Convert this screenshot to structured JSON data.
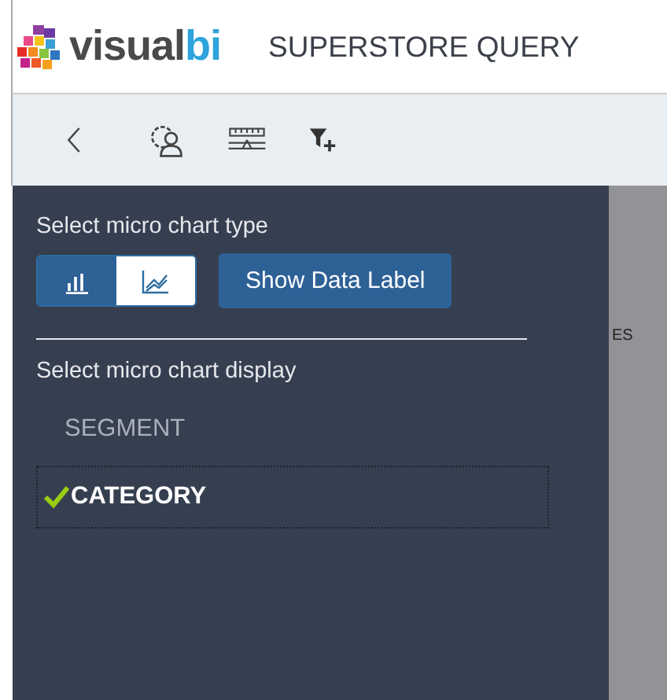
{
  "header": {
    "logo": {
      "text": "visual",
      "accent": "bi"
    },
    "title": "SUPERSTORE QUERY"
  },
  "toolbar": {
    "buttons": [
      {
        "kind": "back"
      },
      {
        "kind": "settings"
      },
      {
        "kind": "ruler"
      },
      {
        "kind": "filter"
      }
    ]
  },
  "background": {
    "text": "ES"
  },
  "panel": {
    "chart_type_label": "Select micro chart type",
    "chart_types": [
      {
        "kind": "bar",
        "selected": true
      },
      {
        "kind": "line",
        "selected": false
      }
    ],
    "data_label_button": "Show Data Label",
    "display_label": "Select micro chart display",
    "display_items": [
      {
        "label": "SEGMENT",
        "checked": false
      },
      {
        "label": "CATEGORY",
        "checked": true
      }
    ]
  }
}
